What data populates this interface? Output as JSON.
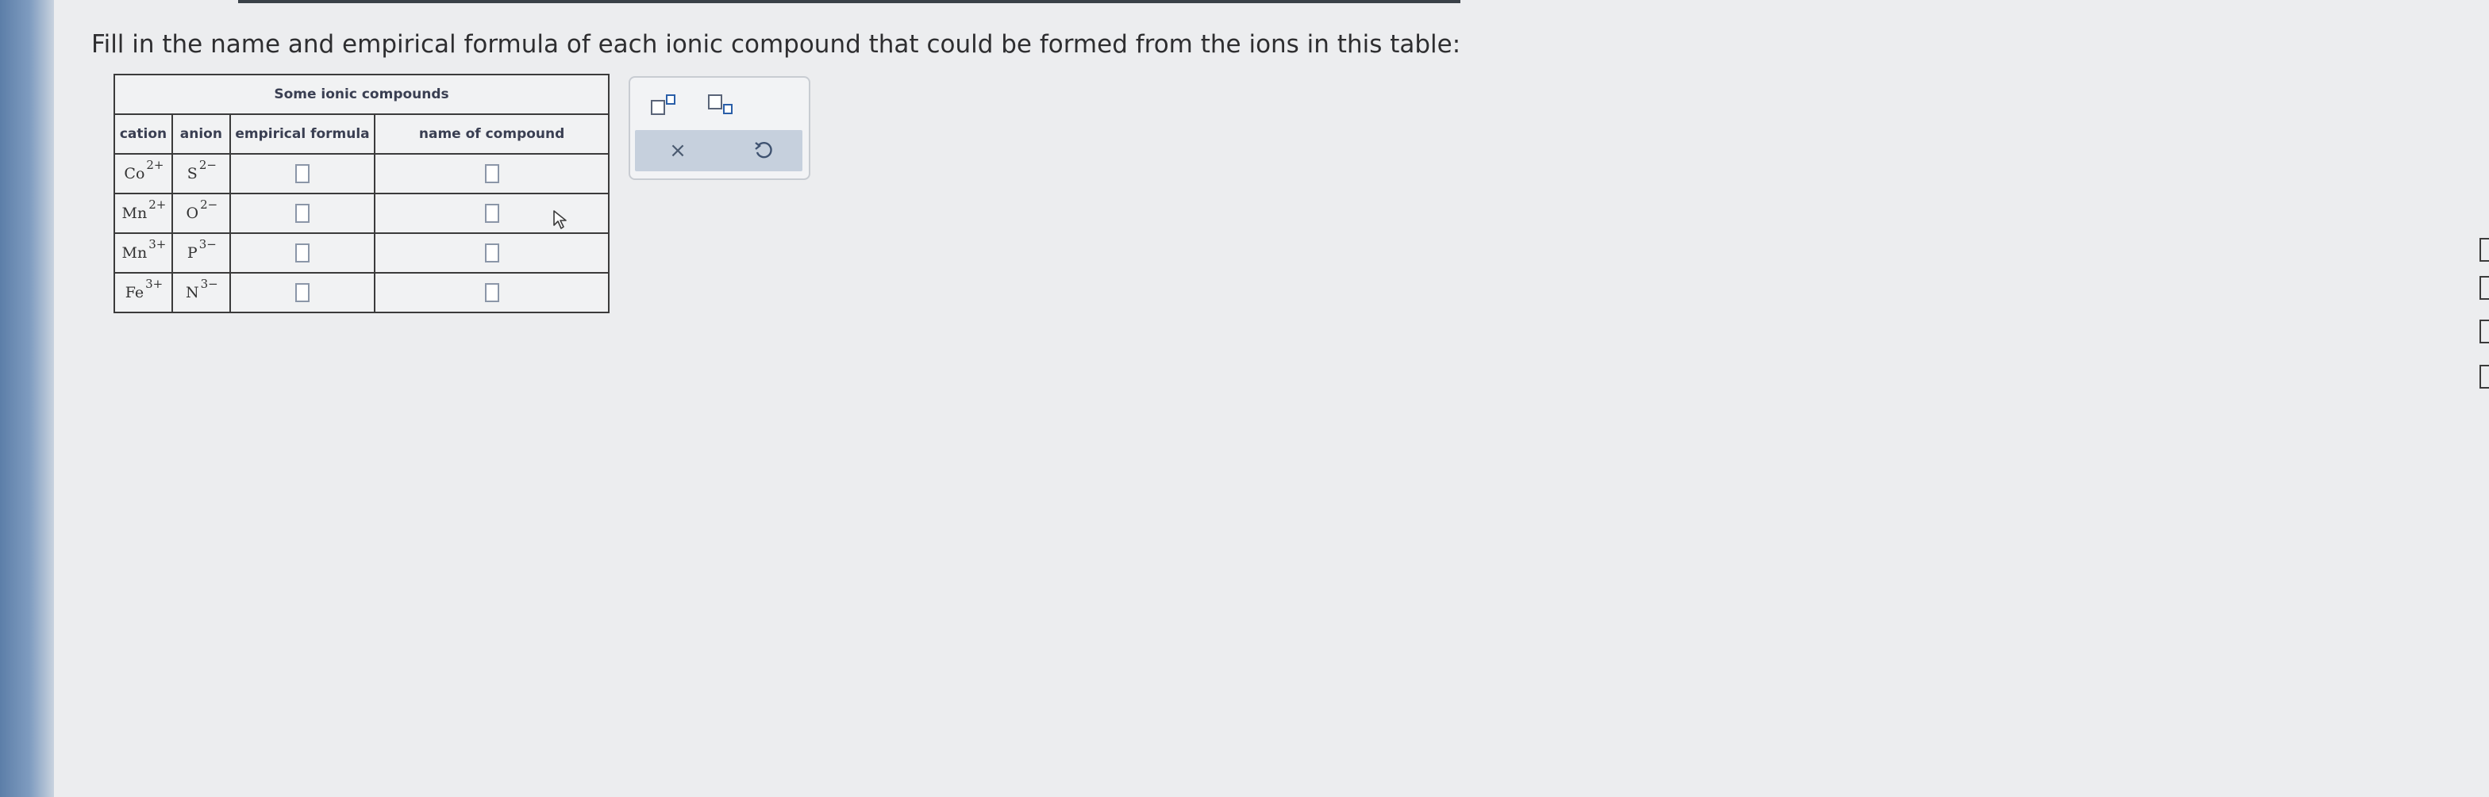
{
  "instructions": "Fill in the name and empirical formula of each ionic compound that could be formed from the ions in this table:",
  "table": {
    "title": "Some ionic compounds",
    "headers": {
      "cation": "cation",
      "anion": "anion",
      "formula": "empirical formula",
      "name": "name of compound"
    },
    "rows": [
      {
        "cation": "Co",
        "cation_charge": "2+",
        "anion": "S",
        "anion_charge": "2−",
        "formula": "",
        "name": ""
      },
      {
        "cation": "Mn",
        "cation_charge": "2+",
        "anion": "O",
        "anion_charge": "2−",
        "formula": "",
        "name": ""
      },
      {
        "cation": "Mn",
        "cation_charge": "3+",
        "anion": "P",
        "anion_charge": "3−",
        "formula": "",
        "name": ""
      },
      {
        "cation": "Fe",
        "cation_charge": "3+",
        "anion": "N",
        "anion_charge": "3−",
        "formula": "",
        "name": ""
      }
    ]
  },
  "tools": {
    "superscript": "superscript-template-icon",
    "subscript": "subscript-template-icon",
    "clear": "×",
    "undo": "undo-icon"
  },
  "colors": {
    "panel_action_bar": "#c6d0dd",
    "table_border": "#3b3b3b",
    "header_text": "#3a3f52"
  }
}
